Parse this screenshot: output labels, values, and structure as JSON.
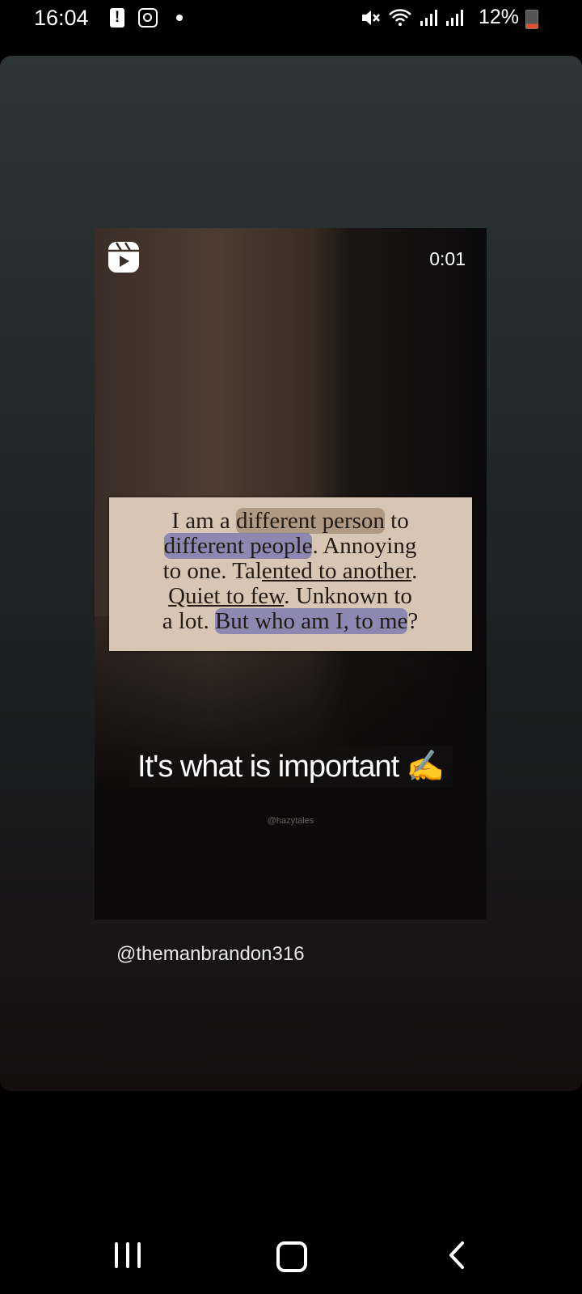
{
  "status_bar": {
    "time": "16:04",
    "battery": "12%",
    "icons": [
      "alert-icon",
      "instagram-icon",
      "dot-icon",
      "mute-icon",
      "wifi-icon",
      "signal-icon",
      "signal-icon",
      "battery-icon"
    ]
  },
  "story": {
    "timer": "0:01",
    "quote": {
      "line1_pre": "I am a ",
      "line1_hl": "different person",
      "line1_post": " to",
      "line2_hl": "different people",
      "line2_post": ". Annoying",
      "line3_pre": "to one. Tal",
      "line3_ul": "ented to another",
      "line3_post": ".",
      "line4_ul": "Quiet to few",
      "line4_post": ". Unknown to",
      "line5_pre": "a lot. ",
      "line5_hl": "But who am I, to me",
      "line5_post": "?"
    },
    "caption": "It's what is important ✍️",
    "watermark": "@hazytales",
    "username": "@themanbrandon316"
  },
  "colors": {
    "battery_low": "#e0522d",
    "background": "#000000"
  }
}
